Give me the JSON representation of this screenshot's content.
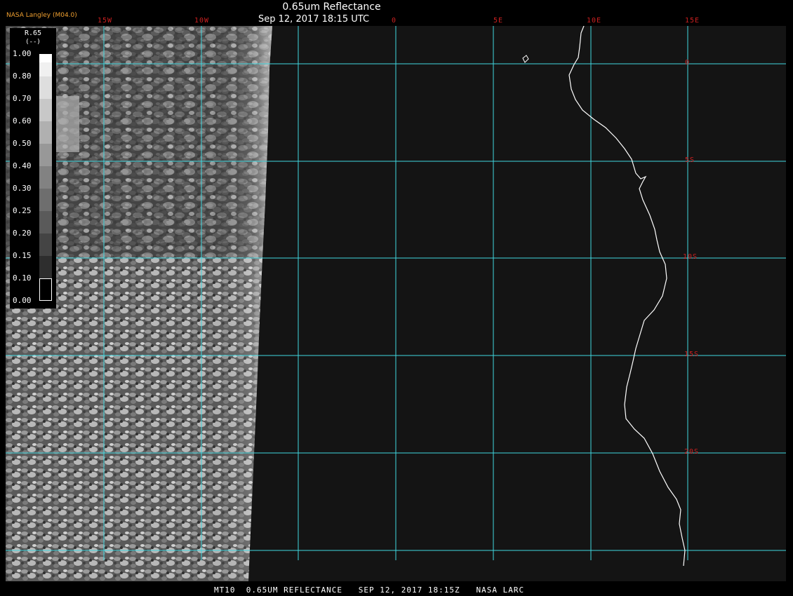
{
  "header": {
    "title": "0.65um Reflectance",
    "subtitle": "Sep 12, 2017 18:15 UTC",
    "credit": "NASA Langley (M04.0)"
  },
  "footer": {
    "text": "MT10  0.65UM REFLECTANCE   SEP 12, 2017 18:15Z   NASA LARC"
  },
  "map": {
    "longitude_labels": [
      "15W",
      "10W",
      "0",
      "5E",
      "10E",
      "15E"
    ],
    "latitude_labels": [
      "0",
      "5S",
      "10S",
      "15S",
      "20S"
    ],
    "gridline_color": "#40d8e0",
    "label_color": "#cc2020",
    "background_color": "#141414",
    "coastline_color": "#ffffff"
  },
  "legend": {
    "title": "R.65",
    "unit": "(--)",
    "ticks": [
      "1.00",
      "0.80",
      "0.70",
      "0.60",
      "0.50",
      "0.40",
      "0.30",
      "0.25",
      "0.20",
      "0.15",
      "0.10",
      "0.00"
    ]
  }
}
